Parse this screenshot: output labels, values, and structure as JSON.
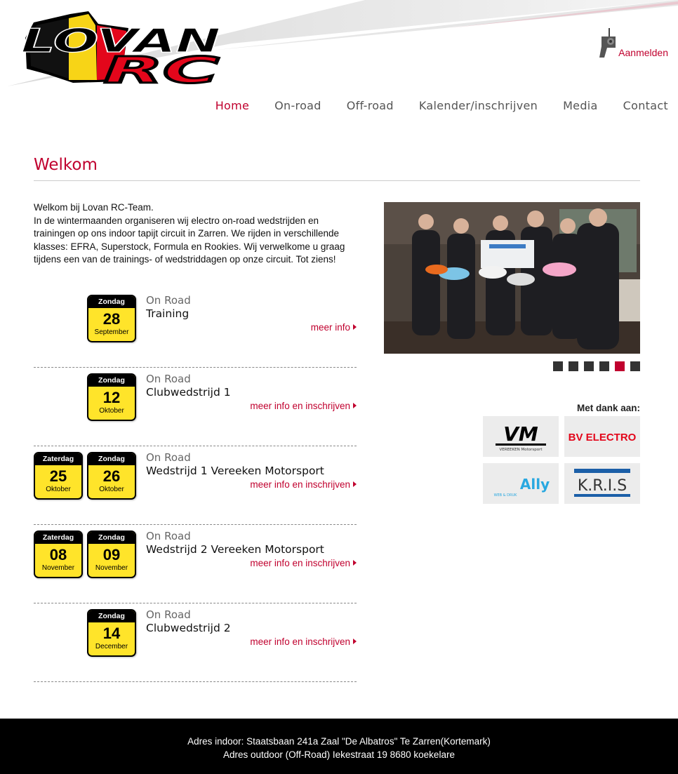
{
  "brand": {
    "logo_top": "LOVAN",
    "logo_bottom": "RC"
  },
  "header": {
    "login_label": "Aanmelden"
  },
  "nav": [
    {
      "label": "Home",
      "active": true
    },
    {
      "label": "On-road",
      "active": false
    },
    {
      "label": "Off-road",
      "active": false
    },
    {
      "label": "Kalender/inschrijven",
      "active": false
    },
    {
      "label": "Media",
      "active": false
    },
    {
      "label": "Contact",
      "active": false
    }
  ],
  "main": {
    "title": "Welkom",
    "intro_line1": "Welkom bij Lovan RC-Team.",
    "intro_line2": "In de wintermaanden organiseren wij electro on-road wedstrijden en trainingen op ons indoor tapijt circuit in Zarren.  We rijden in verschillende klasses: EFRA, Superstock, Formula en Rookies. Wij verwelkome u graag tijdens een van de trainings- of wedstriddagen op onze circuit. Tot ziens!"
  },
  "events": [
    {
      "dates": [
        {
          "day": "Zondag",
          "num": "28",
          "month": "September"
        }
      ],
      "category": "On Road",
      "title": "Training",
      "link": "meer info"
    },
    {
      "dates": [
        {
          "day": "Zondag",
          "num": "12",
          "month": "Oktober"
        }
      ],
      "category": "On Road",
      "title": "Clubwedstrijd 1",
      "link": "meer info en inschrijven"
    },
    {
      "dates": [
        {
          "day": "Zaterdag",
          "num": "25",
          "month": "Oktober"
        },
        {
          "day": "Zondag",
          "num": "26",
          "month": "Oktober"
        }
      ],
      "category": "On Road",
      "title": "Wedstrijd 1 Vereeken Motorsport",
      "link": "meer info en inschrijven"
    },
    {
      "dates": [
        {
          "day": "Zaterdag",
          "num": "08",
          "month": "November"
        },
        {
          "day": "Zondag",
          "num": "09",
          "month": "November"
        }
      ],
      "category": "On Road",
      "title": "Wedstrijd 2 Vereeken Motorsport",
      "link": "meer info en inschrijven"
    },
    {
      "dates": [
        {
          "day": "Zondag",
          "num": "14",
          "month": "December"
        }
      ],
      "category": "On Road",
      "title": "Clubwedstrijd 2",
      "link": "meer info en inschrijven"
    }
  ],
  "slider": {
    "count": 6,
    "active_index": 4
  },
  "sponsors": {
    "heading": "Met dank aan:",
    "items": [
      {
        "name": "VM",
        "sub": "VEREEKEN Motorsport"
      },
      {
        "name": "BV ELECTRO"
      },
      {
        "name": "Ally",
        "sub": "WEB & DRUK"
      },
      {
        "name": "K.R.I.S"
      }
    ]
  },
  "footer": {
    "line1": "Adres indoor: Staatsbaan 241a Zaal \"De Albatros\" Te Zarren(Kortemark)",
    "line2": "Adres outdoor (Off-Road) Iekestraat 19 8680 koekelare"
  },
  "colors": {
    "accent": "#c0002e",
    "badge_yellow": "#ffe42a",
    "footer_bg": "#000000"
  }
}
